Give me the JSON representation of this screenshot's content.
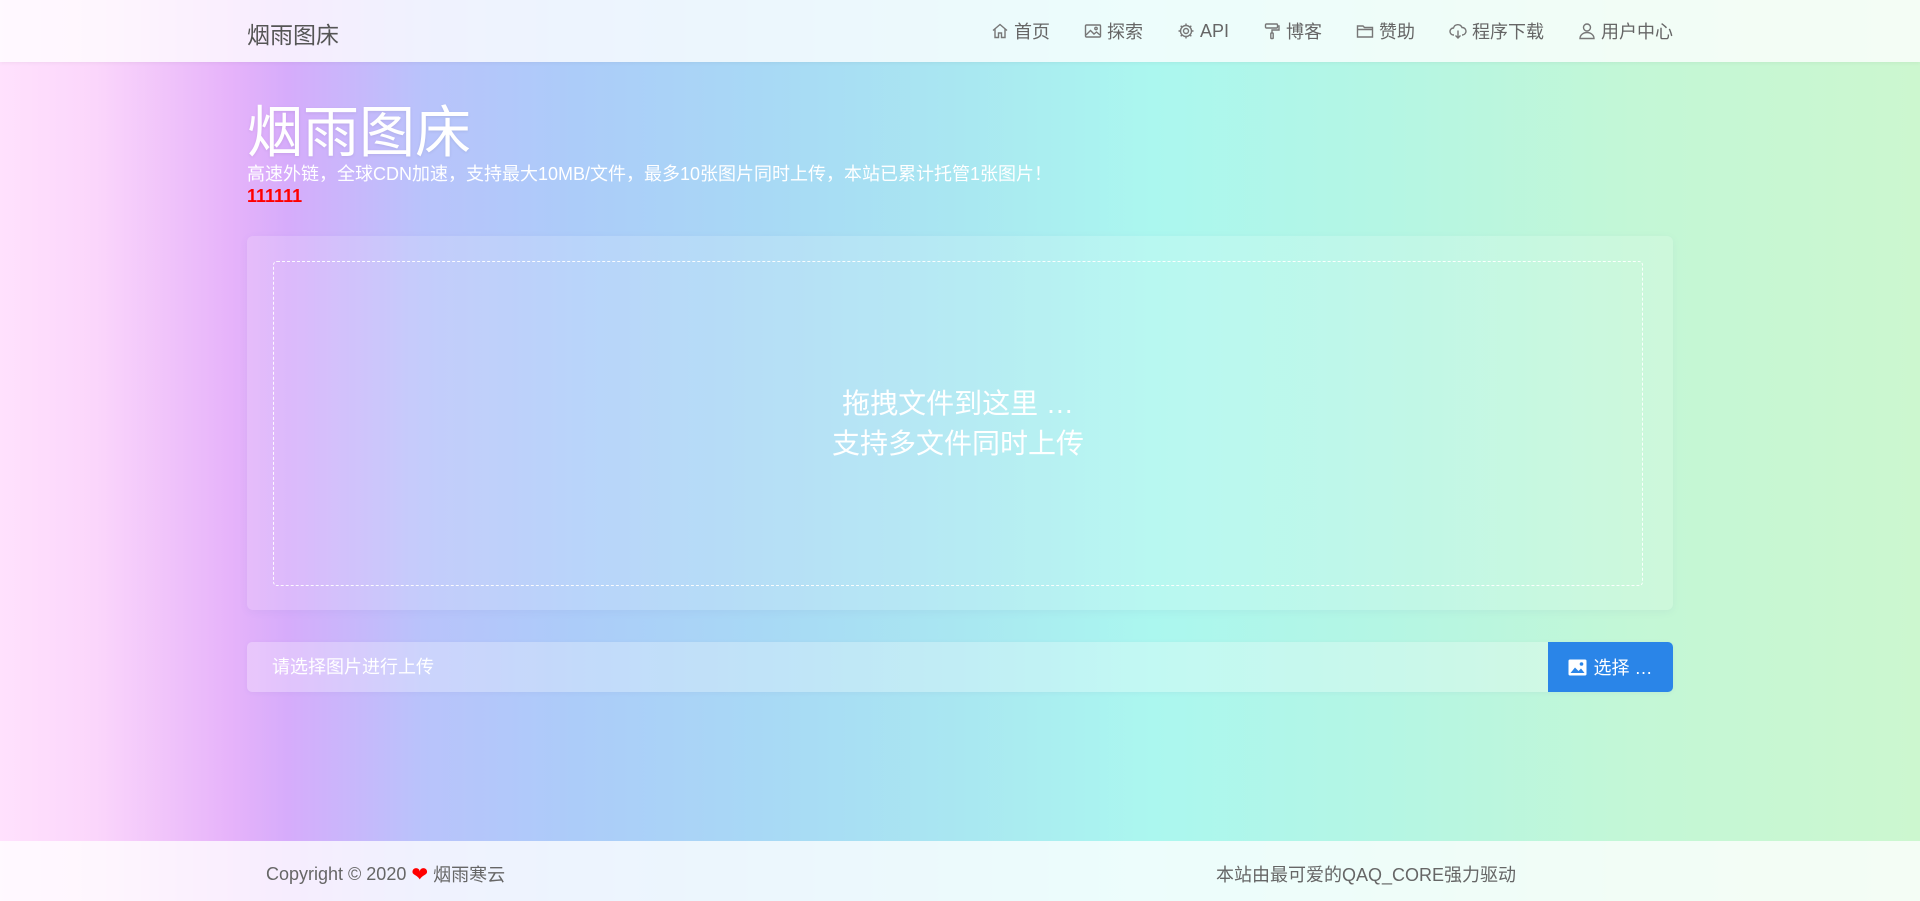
{
  "navbar": {
    "brand": "烟雨图床",
    "items": [
      {
        "label": "首页",
        "icon": "home-icon"
      },
      {
        "label": "探索",
        "icon": "image-icon"
      },
      {
        "label": "API",
        "icon": "gear-icon"
      },
      {
        "label": "博客",
        "icon": "paint-roller-icon"
      },
      {
        "label": "赞助",
        "icon": "folder-icon"
      },
      {
        "label": "程序下载",
        "icon": "cloud-download-icon"
      },
      {
        "label": "用户中心",
        "icon": "user-icon"
      }
    ]
  },
  "header": {
    "title": "烟雨图床",
    "subtitle": "高速外链，全球CDN加速，支持最大10MB/文件，最多10张图片同时上传，本站已累计托管1张图片！",
    "notice": "111111",
    "notice_color": "#ff0000"
  },
  "dropzone": {
    "line1": "拖拽文件到这里 …",
    "line2": "支持多文件同时上传"
  },
  "upload": {
    "placeholder": "请选择图片进行上传",
    "button_label": "选择 …",
    "button_icon": "image-icon",
    "button_color": "#2a85e8"
  },
  "footer": {
    "copyright_prefix": "Copyright © 2020",
    "heart_icon": "heart-icon",
    "author": "烟雨寒云",
    "powered": "本站由最可爱的QAQ_CORE强力驱动"
  }
}
